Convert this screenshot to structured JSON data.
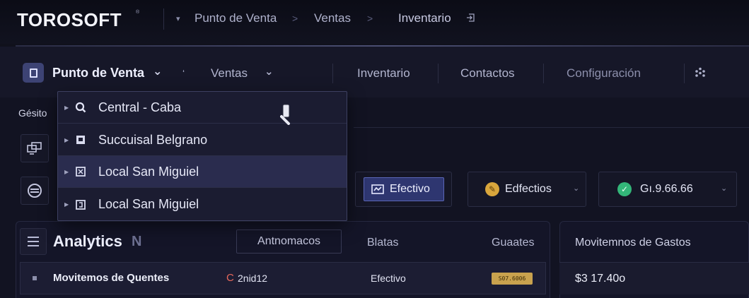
{
  "brand": {
    "logo": "TOROSOFT",
    "trademark": "®"
  },
  "breadcrumb": {
    "items": [
      "Punto de Venta",
      "Ventas",
      "Inventario"
    ],
    "caret": "▾",
    "separator": ">",
    "end_icon": "exit-icon"
  },
  "nav": {
    "app_label": "Punto de Venta",
    "app_caret": "⌄",
    "stray_mark": "ʻ",
    "items": [
      {
        "label": "Ventas",
        "caret": "⌄"
      },
      {
        "label": "Inventario"
      },
      {
        "label": "Contactos"
      },
      {
        "label": "Configuración"
      }
    ]
  },
  "left": {
    "label": "Gésito"
  },
  "dropdown": {
    "items": [
      {
        "label": "Central - Caba",
        "icon": "search-icon"
      },
      {
        "label": "Succuisal Belgrano",
        "icon": "store-icon"
      },
      {
        "label": "Local San Miguiel",
        "icon": "store-icon"
      },
      {
        "label": "Local San Miguiel",
        "icon": "store-icon"
      }
    ],
    "highlighted_index": 2
  },
  "filters": {
    "active_chip": "Efectivo",
    "chip2": "Edfectios",
    "chip3": "Gı.9.66.66",
    "caret": "⌄"
  },
  "analytics": {
    "title": "Analytics",
    "badge_letter": "N",
    "tab_active": "Antnomacos",
    "col2": "Blatas",
    "col3": "Guaates",
    "row": {
      "title": "Movitemos de Quentes",
      "c_mark": "C",
      "amount": "2nid12",
      "method": "Efectivo",
      "badge": "S07.6006"
    }
  },
  "gastos": {
    "title": "Movitemnos de Gastos",
    "amount": "$3 17.40o"
  },
  "colors": {
    "background": "#10111c",
    "active_chip_bg": "#2e3670",
    "accent_gold": "#d9a63c",
    "accent_green": "#33b679",
    "badge_gold": "#c9a24e",
    "red_mark": "#e7685c"
  }
}
